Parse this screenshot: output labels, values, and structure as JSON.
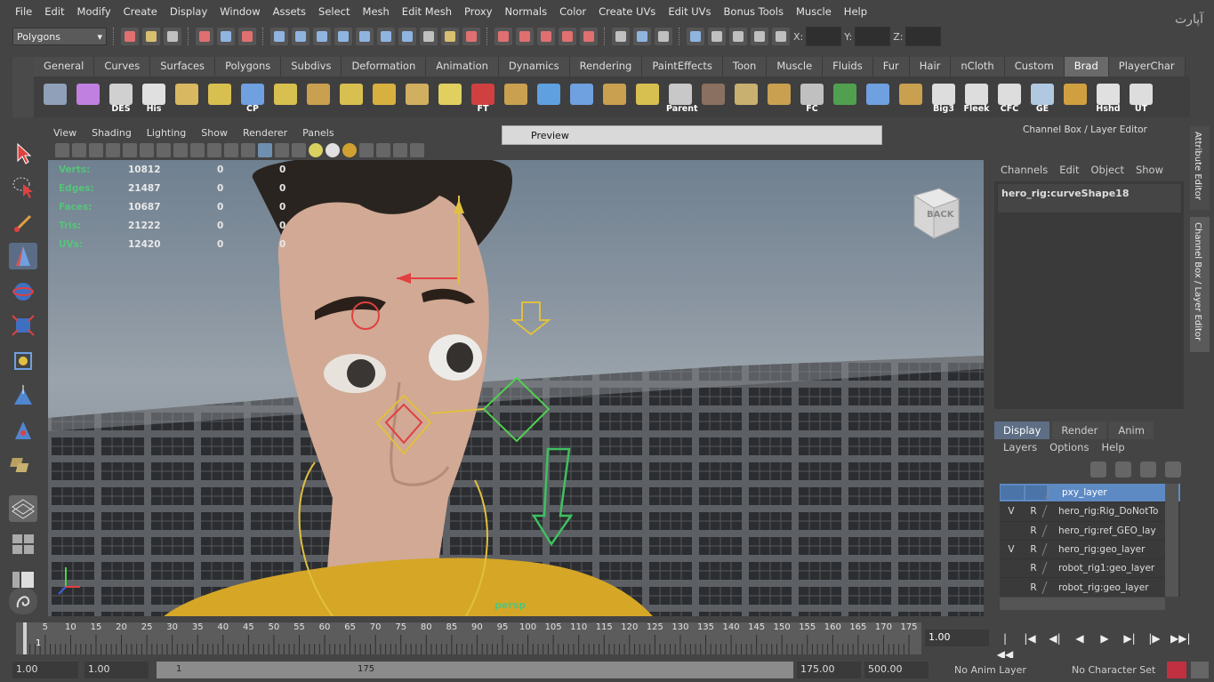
{
  "menubar": [
    "File",
    "Edit",
    "Modify",
    "Create",
    "Display",
    "Window",
    "Assets",
    "Select",
    "Mesh",
    "Edit Mesh",
    "Proxy",
    "Normals",
    "Color",
    "Create UVs",
    "Edit UVs",
    "Bonus Tools",
    "Muscle",
    "Help"
  ],
  "statusline": {
    "mode": "Polygons",
    "x_label": "X:",
    "y_label": "Y:",
    "z_label": "Z:"
  },
  "watermark": "آپارت",
  "shelf_tabs": [
    "General",
    "Curves",
    "Surfaces",
    "Polygons",
    "Subdivs",
    "Deformation",
    "Animation",
    "Dynamics",
    "Rendering",
    "PaintEffects",
    "Toon",
    "Muscle",
    "Fluids",
    "Fur",
    "Hair",
    "nCloth",
    "Custom",
    "Brad",
    "PlayerChar"
  ],
  "shelf_active": "Brad",
  "shelf_labels": [
    "",
    "",
    "DES",
    "His",
    "",
    "",
    "CP",
    "",
    "",
    "",
    "",
    "",
    "",
    "FT",
    "",
    "",
    "",
    "",
    "",
    "Parent",
    "",
    "",
    "",
    "FC",
    "",
    "",
    "",
    "Big3",
    "Fleek",
    "CFC",
    "GE",
    "",
    "Hshd",
    "UT"
  ],
  "viewport_menu": [
    "View",
    "Shading",
    "Lighting",
    "Show",
    "Renderer",
    "Panels"
  ],
  "tooltip": "Preview",
  "hud": [
    {
      "label": "Verts:",
      "v1": "10812",
      "v2": "0",
      "v3": "0"
    },
    {
      "label": "Edges:",
      "v1": "21487",
      "v2": "0",
      "v3": "0"
    },
    {
      "label": "Faces:",
      "v1": "10687",
      "v2": "0",
      "v3": "0"
    },
    {
      "label": "Tris:",
      "v1": "21222",
      "v2": "0",
      "v3": "0"
    },
    {
      "label": "UVs:",
      "v1": "12420",
      "v2": "0",
      "v3": "0"
    }
  ],
  "camera_label": "persp",
  "viewcube_label": "BACK",
  "right_panel": {
    "title": "Channel Box / Layer Editor",
    "menu": [
      "Channels",
      "Edit",
      "Object",
      "Show"
    ],
    "node": "hero_rig:curveShape18",
    "side_tab_attr": "Attribute Editor",
    "side_tab_cb": "Channel Box / Layer Editor"
  },
  "layer_editor": {
    "tabs": [
      "Display",
      "Render",
      "Anim"
    ],
    "active_tab": "Display",
    "menu": [
      "Layers",
      "Options",
      "Help"
    ],
    "layers": [
      {
        "v": "",
        "r": "",
        "name": "pxy_layer",
        "selected": true
      },
      {
        "v": "V",
        "r": "R",
        "name": "hero_rig:Rig_DoNotTo",
        "selected": false
      },
      {
        "v": "",
        "r": "R",
        "name": "hero_rig:ref_GEO_lay",
        "selected": false
      },
      {
        "v": "V",
        "r": "R",
        "name": "hero_rig:geo_layer",
        "selected": false
      },
      {
        "v": "",
        "r": "R",
        "name": "robot_rig1:geo_layer",
        "selected": false
      },
      {
        "v": "",
        "r": "R",
        "name": "robot_rig:geo_layer",
        "selected": false
      }
    ]
  },
  "timeslider": {
    "ticks": [
      "5",
      "10",
      "15",
      "20",
      "25",
      "30",
      "35",
      "40",
      "45",
      "50",
      "55",
      "60",
      "65",
      "70",
      "75",
      "80",
      "85",
      "90",
      "95",
      "100",
      "105",
      "110",
      "115",
      "120",
      "125",
      "130",
      "135",
      "140",
      "145",
      "150",
      "155",
      "160",
      "165",
      "170",
      "175"
    ],
    "current": "1",
    "current_field": "1.00"
  },
  "range": {
    "start_field": "1.00",
    "start_inner": "1.00",
    "bar_start": "1",
    "bar_end": "175",
    "end_inner": "175.00",
    "end_field": "500.00",
    "anim_layer": "No Anim Layer",
    "character_set": "No Character Set"
  },
  "playback": [
    "|◀◀",
    "|◀",
    "◀|",
    "◀",
    "▶",
    "▶|",
    "|▶",
    "▶▶|"
  ],
  "colors": {
    "accent": "#5e8ac4",
    "hud_label": "#55c47a",
    "shelf_tab_active": "#6a6a6a"
  }
}
